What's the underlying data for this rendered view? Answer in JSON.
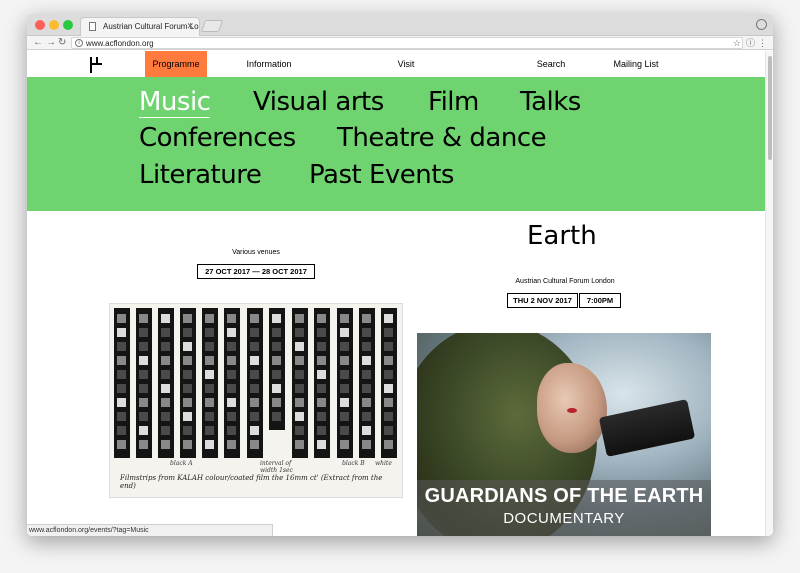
{
  "browser": {
    "tab_title": "Austrian Cultural Forum Londo",
    "tab_close": "✕",
    "url": "www.acflondon.org",
    "status_url": "www.acflondon.org/events/?tag=Music"
  },
  "nav": {
    "items": [
      {
        "label": "Programme",
        "active": true
      },
      {
        "label": "Information",
        "active": false
      },
      {
        "label": "Visit",
        "active": false
      },
      {
        "label": "Search",
        "active": false
      },
      {
        "label": "Mailing List",
        "active": false
      }
    ]
  },
  "categories": [
    {
      "label": "Music",
      "active": true
    },
    {
      "label": "Visual arts",
      "active": false
    },
    {
      "label": "Film",
      "active": false
    },
    {
      "label": "Talks",
      "active": false
    },
    {
      "label": "Conferences",
      "active": false
    },
    {
      "label": "Theatre & dance",
      "active": false
    },
    {
      "label": "Literature",
      "active": false
    },
    {
      "label": "Past Events",
      "active": false
    }
  ],
  "events": {
    "left": {
      "venue": "Various venues",
      "date": "27 OCT 2017 — 28 OCT 2017",
      "image_caption": "Filmstrips from KALAH colour/coated film the 16mm ct' (Extract from the end)",
      "image_notes": [
        "black A",
        "interval of width 1sec",
        "black B",
        "white"
      ]
    },
    "right": {
      "title_fragment": "Earth",
      "venue": "Austrian Cultural Forum London",
      "date": "THU 2 NOV 2017",
      "time": "7:00PM",
      "poster_title": "GUARDIANS OF THE EARTH",
      "poster_subtitle": "DOCUMENTARY"
    }
  },
  "colors": {
    "accent_green": "#6fd470",
    "active_nav": "#ff7a3d"
  }
}
